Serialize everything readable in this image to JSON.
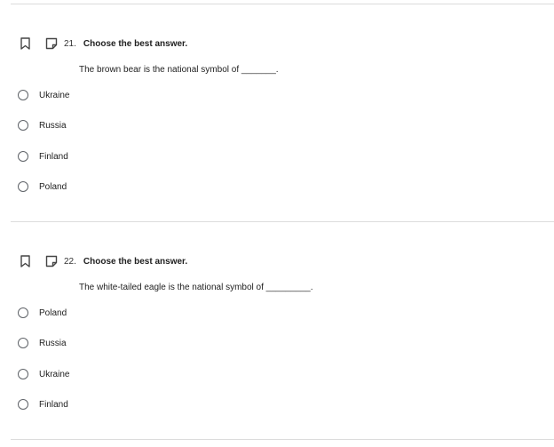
{
  "questions": [
    {
      "number": "21.",
      "title": "Choose the best answer.",
      "prompt": "The brown bear is the national symbol of _______.",
      "options": [
        "Ukraine",
        "Russia",
        "Finland",
        "Poland"
      ]
    },
    {
      "number": "22.",
      "title": "Choose the best answer.",
      "prompt": "The white-tailed eagle is the national symbol of _________.",
      "options": [
        "Poland",
        "Russia",
        "Ukraine",
        "Finland"
      ]
    }
  ],
  "icons": {
    "bookmark": "bookmark-icon",
    "note": "note-icon"
  },
  "colors": {
    "divider": "#dcdcdc",
    "radio_border": "#5f6368",
    "text": "#212121"
  }
}
